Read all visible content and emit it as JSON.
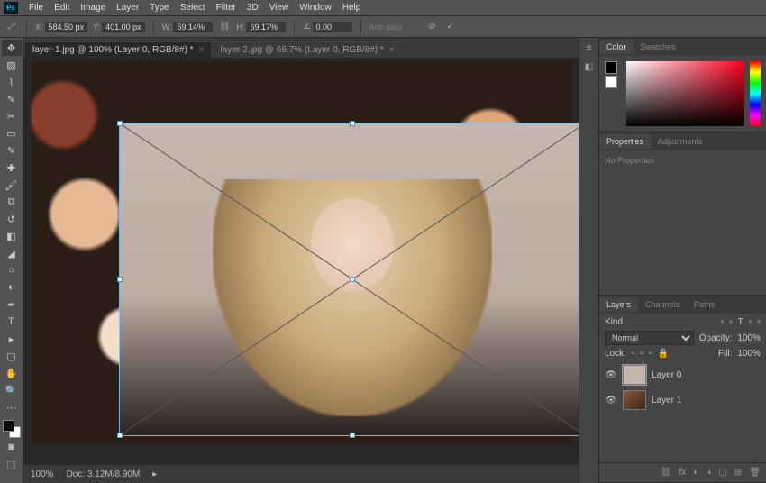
{
  "menu": {
    "items": [
      "File",
      "Edit",
      "Image",
      "Layer",
      "Type",
      "Select",
      "Filter",
      "3D",
      "View",
      "Window",
      "Help"
    ]
  },
  "options": {
    "x_label": "X:",
    "x_val": "584.50 px",
    "y_label": "Y:",
    "y_val": "401.00 px",
    "w_label": "W:",
    "w_val": "69.14%",
    "h_label": "H:",
    "h_val": "69.17%",
    "angle_label": "∠",
    "angle_val": "0.00",
    "antialias": "Anti-alias"
  },
  "tabs": [
    {
      "label": "layer-1.jpg @ 100% (Layer 0, RGB/8#) *"
    },
    {
      "label": "layer-2.jpg @ 66.7% (Layer 0, RGB/8#) *"
    }
  ],
  "status": {
    "zoom": "100%",
    "doc": "Doc: 3.12M/8.90M"
  },
  "color_tabs": {
    "a": "Color",
    "b": "Swatches"
  },
  "props_tabs": {
    "a": "Properties",
    "b": "Adjustments"
  },
  "props_text": "No Properties",
  "layers_tabs": {
    "a": "Layers",
    "b": "Channels",
    "c": "Paths"
  },
  "layers": {
    "kind": "Kind",
    "blend": "Normal",
    "opacity_label": "Opacity:",
    "opacity": "100%",
    "lock": "Lock:",
    "fill_label": "Fill:",
    "fill": "100%",
    "items": [
      {
        "name": "Layer 0"
      },
      {
        "name": "Layer 1"
      }
    ]
  }
}
